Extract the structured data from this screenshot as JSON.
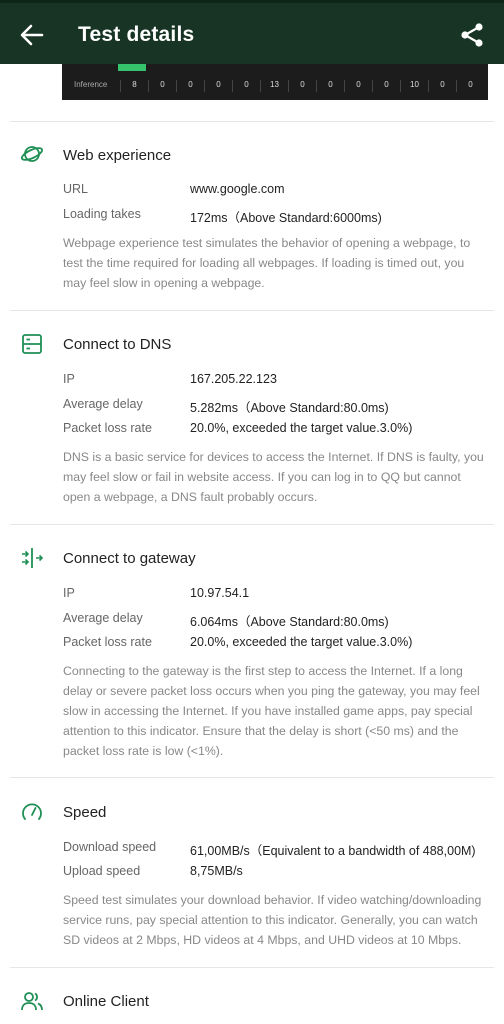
{
  "header": {
    "title": "Test details"
  },
  "chart_strip": {
    "row_label": "Inference",
    "values": [
      "8",
      "0",
      "0",
      "0",
      "0",
      "13",
      "0",
      "0",
      "0",
      "0",
      "10",
      "0",
      "0"
    ]
  },
  "web": {
    "title": "Web experience",
    "rows": [
      {
        "key": "URL",
        "value": "www.google.com"
      },
      {
        "key": "Loading takes",
        "value": "172ms（Above Standard:6000ms)"
      }
    ],
    "description": "Webpage experience test simulates the behavior of opening a webpage, to test the time required for loading all webpages. If loading is timed out, you may feel slow in opening a webpage."
  },
  "dns": {
    "title": "Connect to DNS",
    "rows": [
      {
        "key": "IP",
        "value": "167.205.22.123"
      },
      {
        "key": "Average delay",
        "value": "5.282ms（Above Standard:80.0ms)"
      },
      {
        "key": "Packet loss rate",
        "value": "20.0%, exceeded the target value.3.0%)"
      }
    ],
    "description": "DNS is a basic service for devices to access the Internet. If DNS is faulty, you may feel slow or fail in website access. If you can log in to QQ but cannot open a webpage, a DNS fault probably occurs."
  },
  "gateway": {
    "title": "Connect to gateway",
    "rows": [
      {
        "key": "IP",
        "value": "10.97.54.1"
      },
      {
        "key": "Average delay",
        "value": "6.064ms（Above Standard:80.0ms)"
      },
      {
        "key": "Packet loss rate",
        "value": "20.0%, exceeded the target value.3.0%)"
      }
    ],
    "description": "Connecting to the gateway is the first step to access the Internet. If a long delay or severe packet loss occurs when you ping the gateway, you may feel slow in accessing the Internet. If you have installed game apps, pay special attention to this indicator. Ensure that the delay is short (<50 ms) and the packet loss rate is low (<1%)."
  },
  "speed": {
    "title": "Speed",
    "rows": [
      {
        "key": "Download speed",
        "value": "61,00MB/s（Equivalent to a bandwidth of 488,00M)"
      },
      {
        "key": "Upload speed",
        "value": "8,75MB/s"
      }
    ],
    "description": "Speed test simulates your download behavior. If video watching/downloading service runs, pay special attention to this indicator. Generally, you can watch SD videos at 2 Mbps, HD videos at 4 Mbps, and UHD videos at 10 Mbps."
  },
  "client": {
    "title": "Online Client"
  },
  "colors": {
    "appbar": "#173424",
    "accent": "#1f8f55"
  }
}
